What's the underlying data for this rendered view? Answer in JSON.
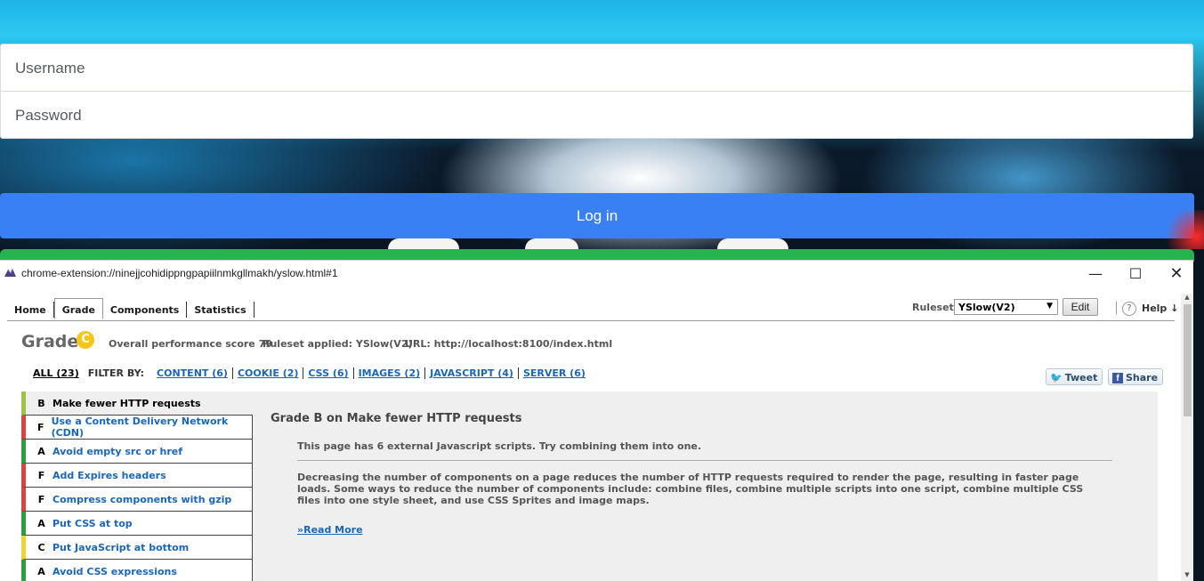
{
  "login": {
    "username_placeholder": "Username",
    "password_placeholder": "Password",
    "login_label": "Log in"
  },
  "window": {
    "title": "chrome-extension://ninejjcohidippngpapiilnmkgllmakh/yslow.html#1",
    "minimize": "—",
    "maximize": "☐",
    "close": "✕"
  },
  "tabs": [
    {
      "label": "Home",
      "active": false
    },
    {
      "label": "Grade",
      "active": true
    },
    {
      "label": "Components",
      "active": false
    },
    {
      "label": "Statistics",
      "active": false
    }
  ],
  "toolbar": {
    "rulesets_label": "Rulesets",
    "ruleset_selected": "YSlow(V2)",
    "edit_label": "Edit",
    "help_icon": "?",
    "help_label": "Help ↓"
  },
  "grade": {
    "heading": "Grade",
    "letter": "C",
    "score_text": "Overall performance score 79",
    "ruleset_text": "Ruleset applied: YSlow(V2)",
    "url_text": "URL: http://localhost:8100/index.html"
  },
  "filters": {
    "all": "ALL (23)",
    "filter_by": "FILTER BY:",
    "items": [
      "CONTENT (6)",
      "COOKIE (2)",
      "CSS (6)",
      "IMAGES (2)",
      "JAVASCRIPT (4)",
      "SERVER (6)"
    ]
  },
  "share": {
    "tweet": "Tweet",
    "share": "Share"
  },
  "colors": {
    "grade_a": "#2d9e3c",
    "grade_b": "#9bc24a",
    "grade_c": "#f2d230",
    "grade_f": "#d9443e",
    "login_button": "#3a80f5",
    "link": "#1a66b8"
  },
  "rules": [
    {
      "grade": "B",
      "text": "Make fewer HTTP requests",
      "selected": true
    },
    {
      "grade": "F",
      "text": "Use a Content Delivery Network (CDN)",
      "selected": false
    },
    {
      "grade": "A",
      "text": "Avoid empty src or href",
      "selected": false
    },
    {
      "grade": "F",
      "text": "Add Expires headers",
      "selected": false
    },
    {
      "grade": "F",
      "text": "Compress components with gzip",
      "selected": false
    },
    {
      "grade": "A",
      "text": "Put CSS at top",
      "selected": false
    },
    {
      "grade": "C",
      "text": "Put JavaScript at bottom",
      "selected": false
    },
    {
      "grade": "A",
      "text": "Avoid CSS expressions",
      "selected": false
    }
  ],
  "detail": {
    "title": "Grade B on Make fewer HTTP requests",
    "finding": "This page has 6 external Javascript scripts. Try combining them into one.",
    "description": "Decreasing the number of components on a page reduces the number of HTTP requests required to render the page, resulting in faster page loads. Some ways to reduce the number of components include: combine files, combine multiple scripts into one script, combine multiple CSS files into one style sheet, and use CSS Sprites and image maps.",
    "read_more": "»Read More"
  }
}
